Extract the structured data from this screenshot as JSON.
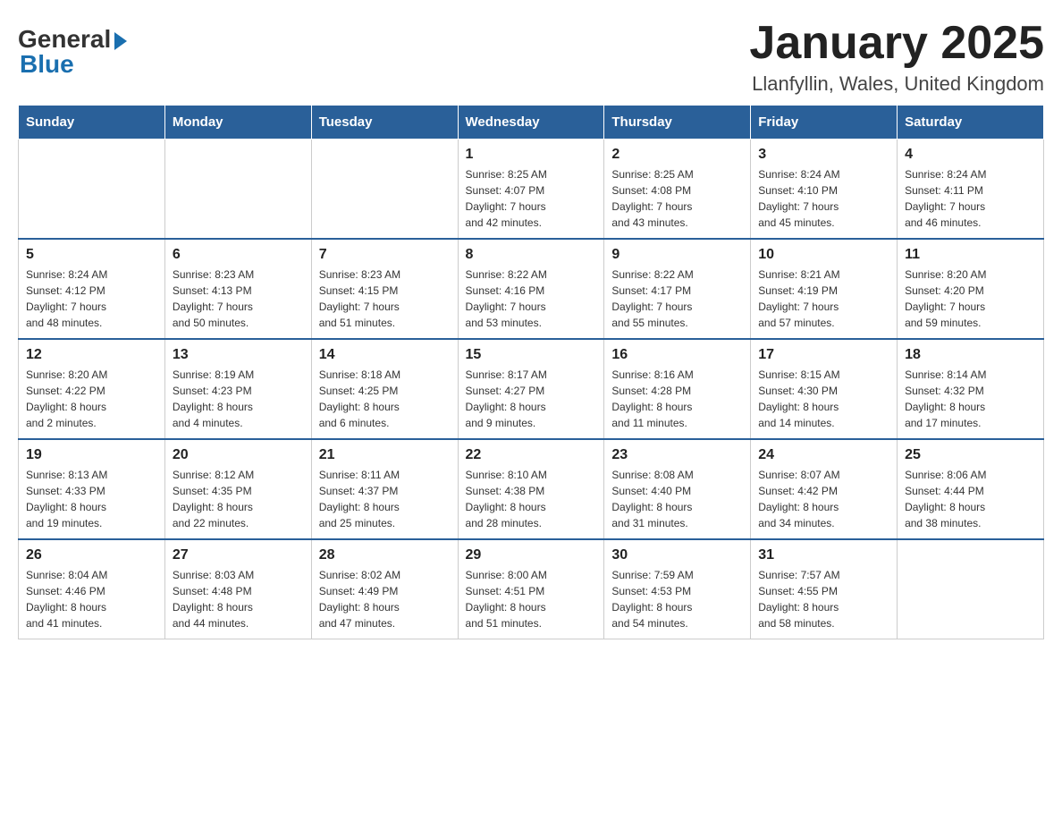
{
  "header": {
    "logo_general": "General",
    "logo_blue": "Blue",
    "month_title": "January 2025",
    "location": "Llanfyllin, Wales, United Kingdom"
  },
  "days_of_week": [
    "Sunday",
    "Monday",
    "Tuesday",
    "Wednesday",
    "Thursday",
    "Friday",
    "Saturday"
  ],
  "weeks": [
    [
      {
        "day": "",
        "info": ""
      },
      {
        "day": "",
        "info": ""
      },
      {
        "day": "",
        "info": ""
      },
      {
        "day": "1",
        "info": "Sunrise: 8:25 AM\nSunset: 4:07 PM\nDaylight: 7 hours\nand 42 minutes."
      },
      {
        "day": "2",
        "info": "Sunrise: 8:25 AM\nSunset: 4:08 PM\nDaylight: 7 hours\nand 43 minutes."
      },
      {
        "day": "3",
        "info": "Sunrise: 8:24 AM\nSunset: 4:10 PM\nDaylight: 7 hours\nand 45 minutes."
      },
      {
        "day": "4",
        "info": "Sunrise: 8:24 AM\nSunset: 4:11 PM\nDaylight: 7 hours\nand 46 minutes."
      }
    ],
    [
      {
        "day": "5",
        "info": "Sunrise: 8:24 AM\nSunset: 4:12 PM\nDaylight: 7 hours\nand 48 minutes."
      },
      {
        "day": "6",
        "info": "Sunrise: 8:23 AM\nSunset: 4:13 PM\nDaylight: 7 hours\nand 50 minutes."
      },
      {
        "day": "7",
        "info": "Sunrise: 8:23 AM\nSunset: 4:15 PM\nDaylight: 7 hours\nand 51 minutes."
      },
      {
        "day": "8",
        "info": "Sunrise: 8:22 AM\nSunset: 4:16 PM\nDaylight: 7 hours\nand 53 minutes."
      },
      {
        "day": "9",
        "info": "Sunrise: 8:22 AM\nSunset: 4:17 PM\nDaylight: 7 hours\nand 55 minutes."
      },
      {
        "day": "10",
        "info": "Sunrise: 8:21 AM\nSunset: 4:19 PM\nDaylight: 7 hours\nand 57 minutes."
      },
      {
        "day": "11",
        "info": "Sunrise: 8:20 AM\nSunset: 4:20 PM\nDaylight: 7 hours\nand 59 minutes."
      }
    ],
    [
      {
        "day": "12",
        "info": "Sunrise: 8:20 AM\nSunset: 4:22 PM\nDaylight: 8 hours\nand 2 minutes."
      },
      {
        "day": "13",
        "info": "Sunrise: 8:19 AM\nSunset: 4:23 PM\nDaylight: 8 hours\nand 4 minutes."
      },
      {
        "day": "14",
        "info": "Sunrise: 8:18 AM\nSunset: 4:25 PM\nDaylight: 8 hours\nand 6 minutes."
      },
      {
        "day": "15",
        "info": "Sunrise: 8:17 AM\nSunset: 4:27 PM\nDaylight: 8 hours\nand 9 minutes."
      },
      {
        "day": "16",
        "info": "Sunrise: 8:16 AM\nSunset: 4:28 PM\nDaylight: 8 hours\nand 11 minutes."
      },
      {
        "day": "17",
        "info": "Sunrise: 8:15 AM\nSunset: 4:30 PM\nDaylight: 8 hours\nand 14 minutes."
      },
      {
        "day": "18",
        "info": "Sunrise: 8:14 AM\nSunset: 4:32 PM\nDaylight: 8 hours\nand 17 minutes."
      }
    ],
    [
      {
        "day": "19",
        "info": "Sunrise: 8:13 AM\nSunset: 4:33 PM\nDaylight: 8 hours\nand 19 minutes."
      },
      {
        "day": "20",
        "info": "Sunrise: 8:12 AM\nSunset: 4:35 PM\nDaylight: 8 hours\nand 22 minutes."
      },
      {
        "day": "21",
        "info": "Sunrise: 8:11 AM\nSunset: 4:37 PM\nDaylight: 8 hours\nand 25 minutes."
      },
      {
        "day": "22",
        "info": "Sunrise: 8:10 AM\nSunset: 4:38 PM\nDaylight: 8 hours\nand 28 minutes."
      },
      {
        "day": "23",
        "info": "Sunrise: 8:08 AM\nSunset: 4:40 PM\nDaylight: 8 hours\nand 31 minutes."
      },
      {
        "day": "24",
        "info": "Sunrise: 8:07 AM\nSunset: 4:42 PM\nDaylight: 8 hours\nand 34 minutes."
      },
      {
        "day": "25",
        "info": "Sunrise: 8:06 AM\nSunset: 4:44 PM\nDaylight: 8 hours\nand 38 minutes."
      }
    ],
    [
      {
        "day": "26",
        "info": "Sunrise: 8:04 AM\nSunset: 4:46 PM\nDaylight: 8 hours\nand 41 minutes."
      },
      {
        "day": "27",
        "info": "Sunrise: 8:03 AM\nSunset: 4:48 PM\nDaylight: 8 hours\nand 44 minutes."
      },
      {
        "day": "28",
        "info": "Sunrise: 8:02 AM\nSunset: 4:49 PM\nDaylight: 8 hours\nand 47 minutes."
      },
      {
        "day": "29",
        "info": "Sunrise: 8:00 AM\nSunset: 4:51 PM\nDaylight: 8 hours\nand 51 minutes."
      },
      {
        "day": "30",
        "info": "Sunrise: 7:59 AM\nSunset: 4:53 PM\nDaylight: 8 hours\nand 54 minutes."
      },
      {
        "day": "31",
        "info": "Sunrise: 7:57 AM\nSunset: 4:55 PM\nDaylight: 8 hours\nand 58 minutes."
      },
      {
        "day": "",
        "info": ""
      }
    ]
  ]
}
